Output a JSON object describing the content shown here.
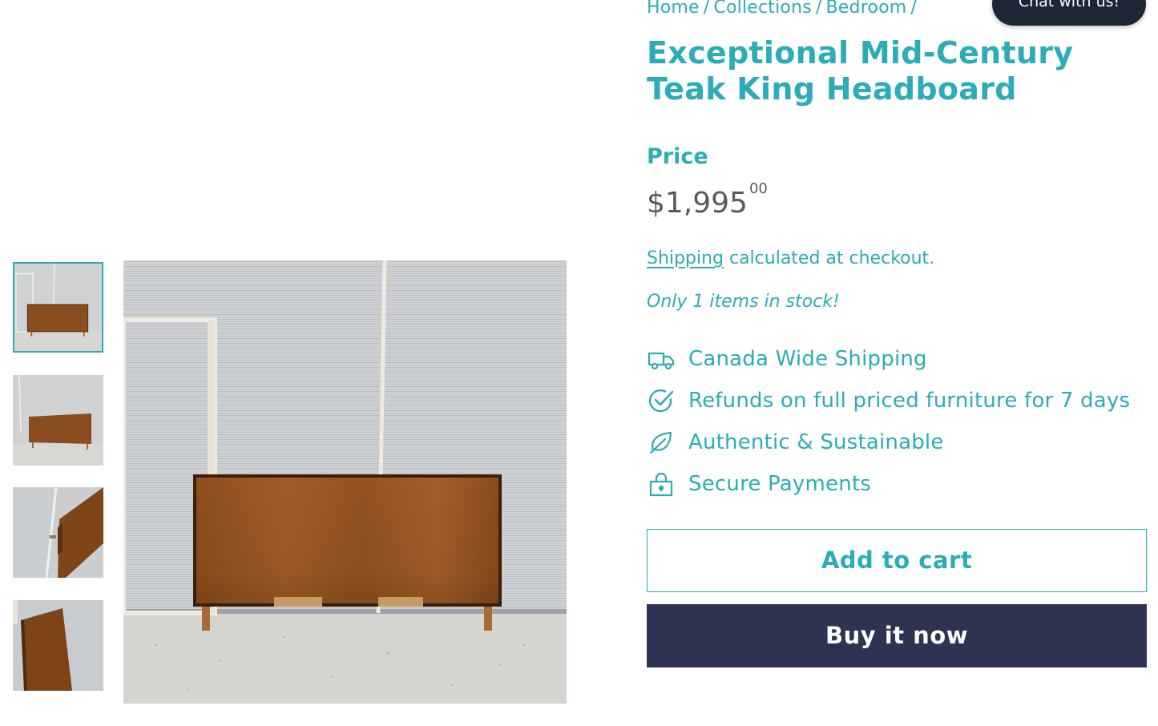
{
  "breadcrumb": {
    "items": [
      "Home",
      "Collections",
      "Bedroom"
    ],
    "separator": "/"
  },
  "chat": {
    "label": "Chat with us!"
  },
  "product": {
    "title": "Exceptional Mid-Century Teak King Headboard",
    "price_label": "Price",
    "price_main": "$1,995",
    "price_cents": "00",
    "shipping_link": "Shipping",
    "shipping_rest": " calculated at checkout.",
    "stock": "Only 1 items in stock!"
  },
  "features": [
    {
      "icon": "truck-icon",
      "text": "Canada Wide Shipping"
    },
    {
      "icon": "check-circle-icon",
      "text": "Refunds on full priced furniture for 7 days"
    },
    {
      "icon": "leaf-icon",
      "text": "Authentic & Sustainable"
    },
    {
      "icon": "lock-icon",
      "text": "Secure Payments"
    }
  ],
  "buttons": {
    "add_to_cart": "Add to cart",
    "buy_now": "Buy it now"
  },
  "gallery": {
    "thumbnail_count": 4,
    "active_index": 0
  },
  "colors": {
    "accent": "#2bacb6",
    "buy_button": "#2d3350",
    "chat_button": "#1d2634",
    "price_text": "#555a60"
  }
}
